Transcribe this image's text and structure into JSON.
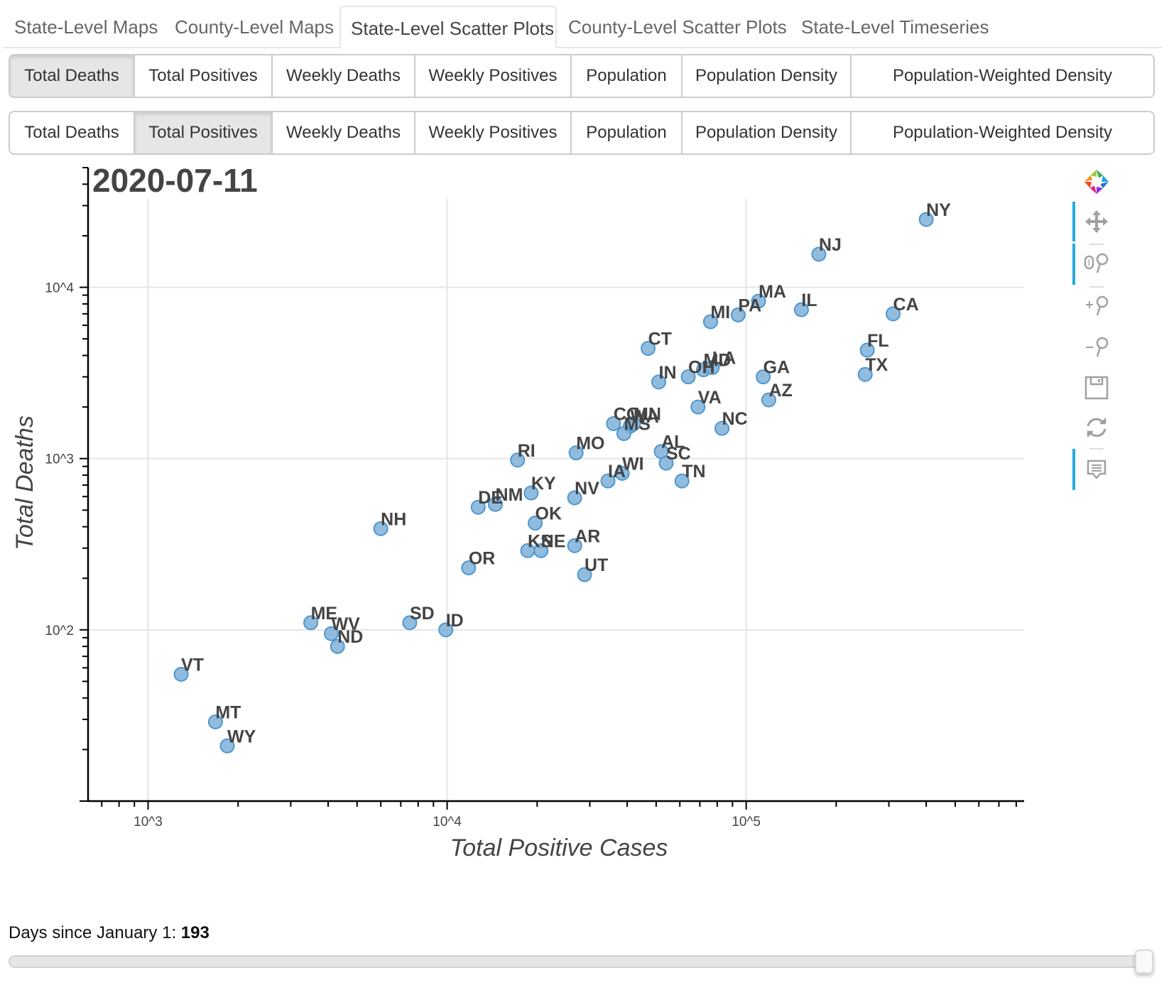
{
  "top_tabs": [
    {
      "label": "State-Level Maps",
      "active": false
    },
    {
      "label": "County-Level Maps",
      "active": false
    },
    {
      "label": "State-Level Scatter Plots",
      "active": true
    },
    {
      "label": "County-Level Scatter Plots",
      "active": false
    },
    {
      "label": "State-Level Timeseries",
      "active": false
    }
  ],
  "y_metric_buttons": {
    "selected": "Total Deaths",
    "labels": [
      "Total Deaths",
      "Total Positives",
      "Weekly Deaths",
      "Weekly Positives",
      "Population",
      "Population Density",
      "Population-Weighted Density"
    ]
  },
  "x_metric_buttons": {
    "selected": "Total Positives",
    "labels": [
      "Total Deaths",
      "Total Positives",
      "Weekly Deaths",
      "Weekly Positives",
      "Population",
      "Population Density",
      "Population-Weighted Density"
    ]
  },
  "toolbar": {
    "tools": [
      {
        "name": "bokeh-logo-icon",
        "active": false
      },
      {
        "name": "pan-icon",
        "active": true
      },
      {
        "name": "wheel-zoom-icon",
        "active": true
      },
      {
        "name": "zoom-in-icon",
        "active": false
      },
      {
        "name": "zoom-out-icon",
        "active": false
      },
      {
        "name": "save-icon",
        "active": false
      },
      {
        "name": "reset-icon",
        "active": false
      },
      {
        "name": "hover-icon",
        "active": true
      }
    ]
  },
  "slider": {
    "label": "Days since January 1: ",
    "value": "193",
    "min_fraction": 0,
    "value_fraction": 1.0
  },
  "chart_data": {
    "type": "scatter",
    "title": "2020-07-11",
    "xlabel": "Total Positive Cases",
    "ylabel": "Total Deaths",
    "x_scale": "log",
    "y_scale": "log",
    "xlim": [
      630,
      850000
    ],
    "ylim": [
      10,
      50000
    ],
    "x_ticks": [
      {
        "value": 1000,
        "label": "10^3"
      },
      {
        "value": 10000,
        "label": "10^4"
      },
      {
        "value": 100000,
        "label": "10^5"
      }
    ],
    "y_ticks": [
      {
        "value": 100,
        "label": "10^2"
      },
      {
        "value": 1000,
        "label": "10^3"
      },
      {
        "value": 10000,
        "label": "10^4"
      }
    ],
    "grid": true,
    "marker_color": "#7fb0d8",
    "points": [
      {
        "label": "NY",
        "x": 400000,
        "y": 24900
      },
      {
        "label": "NJ",
        "x": 175000,
        "y": 15600
      },
      {
        "label": "MA",
        "x": 110000,
        "y": 8300
      },
      {
        "label": "IL",
        "x": 153000,
        "y": 7400
      },
      {
        "label": "CA",
        "x": 310000,
        "y": 7000
      },
      {
        "label": "PA",
        "x": 94000,
        "y": 6900
      },
      {
        "label": "MI",
        "x": 76000,
        "y": 6300
      },
      {
        "label": "FL",
        "x": 254000,
        "y": 4300
      },
      {
        "label": "CT",
        "x": 47000,
        "y": 4400
      },
      {
        "label": "TX",
        "x": 250000,
        "y": 3100
      },
      {
        "label": "GA",
        "x": 114000,
        "y": 3000
      },
      {
        "label": "IN",
        "x": 51000,
        "y": 2800
      },
      {
        "label": "OH",
        "x": 64000,
        "y": 3000
      },
      {
        "label": "MD",
        "x": 72000,
        "y": 3300
      },
      {
        "label": "LA",
        "x": 77000,
        "y": 3400
      },
      {
        "label": "AZ",
        "x": 119000,
        "y": 2200
      },
      {
        "label": "VA",
        "x": 69000,
        "y": 2000
      },
      {
        "label": "NC",
        "x": 83000,
        "y": 1500
      },
      {
        "label": "CO",
        "x": 36000,
        "y": 1600
      },
      {
        "label": "WA",
        "x": 41000,
        "y": 1550
      },
      {
        "label": "MN",
        "x": 42000,
        "y": 1600
      },
      {
        "label": "MS",
        "x": 39000,
        "y": 1400
      },
      {
        "label": "MO",
        "x": 27000,
        "y": 1080
      },
      {
        "label": "AL",
        "x": 52000,
        "y": 1100
      },
      {
        "label": "SC",
        "x": 54000,
        "y": 940
      },
      {
        "label": "RI",
        "x": 17200,
        "y": 980
      },
      {
        "label": "WI",
        "x": 38500,
        "y": 820
      },
      {
        "label": "IA",
        "x": 34500,
        "y": 740
      },
      {
        "label": "TN",
        "x": 61000,
        "y": 740
      },
      {
        "label": "KY",
        "x": 19100,
        "y": 630
      },
      {
        "label": "NV",
        "x": 26700,
        "y": 590
      },
      {
        "label": "NM",
        "x": 14500,
        "y": 540
      },
      {
        "label": "DE",
        "x": 12700,
        "y": 520
      },
      {
        "label": "OK",
        "x": 19700,
        "y": 420
      },
      {
        "label": "NH",
        "x": 6000,
        "y": 390
      },
      {
        "label": "AR",
        "x": 26700,
        "y": 310
      },
      {
        "label": "NE",
        "x": 20600,
        "y": 290
      },
      {
        "label": "KS",
        "x": 18600,
        "y": 290
      },
      {
        "label": "UT",
        "x": 28800,
        "y": 210
      },
      {
        "label": "OR",
        "x": 11800,
        "y": 230
      },
      {
        "label": "ME",
        "x": 3500,
        "y": 110
      },
      {
        "label": "SD",
        "x": 7500,
        "y": 110
      },
      {
        "label": "WV",
        "x": 4100,
        "y": 95
      },
      {
        "label": "ID",
        "x": 9900,
        "y": 100
      },
      {
        "label": "ND",
        "x": 4300,
        "y": 80
      },
      {
        "label": "VT",
        "x": 1290,
        "y": 55
      },
      {
        "label": "MT",
        "x": 1680,
        "y": 29
      },
      {
        "label": "WY",
        "x": 1840,
        "y": 21
      }
    ]
  }
}
